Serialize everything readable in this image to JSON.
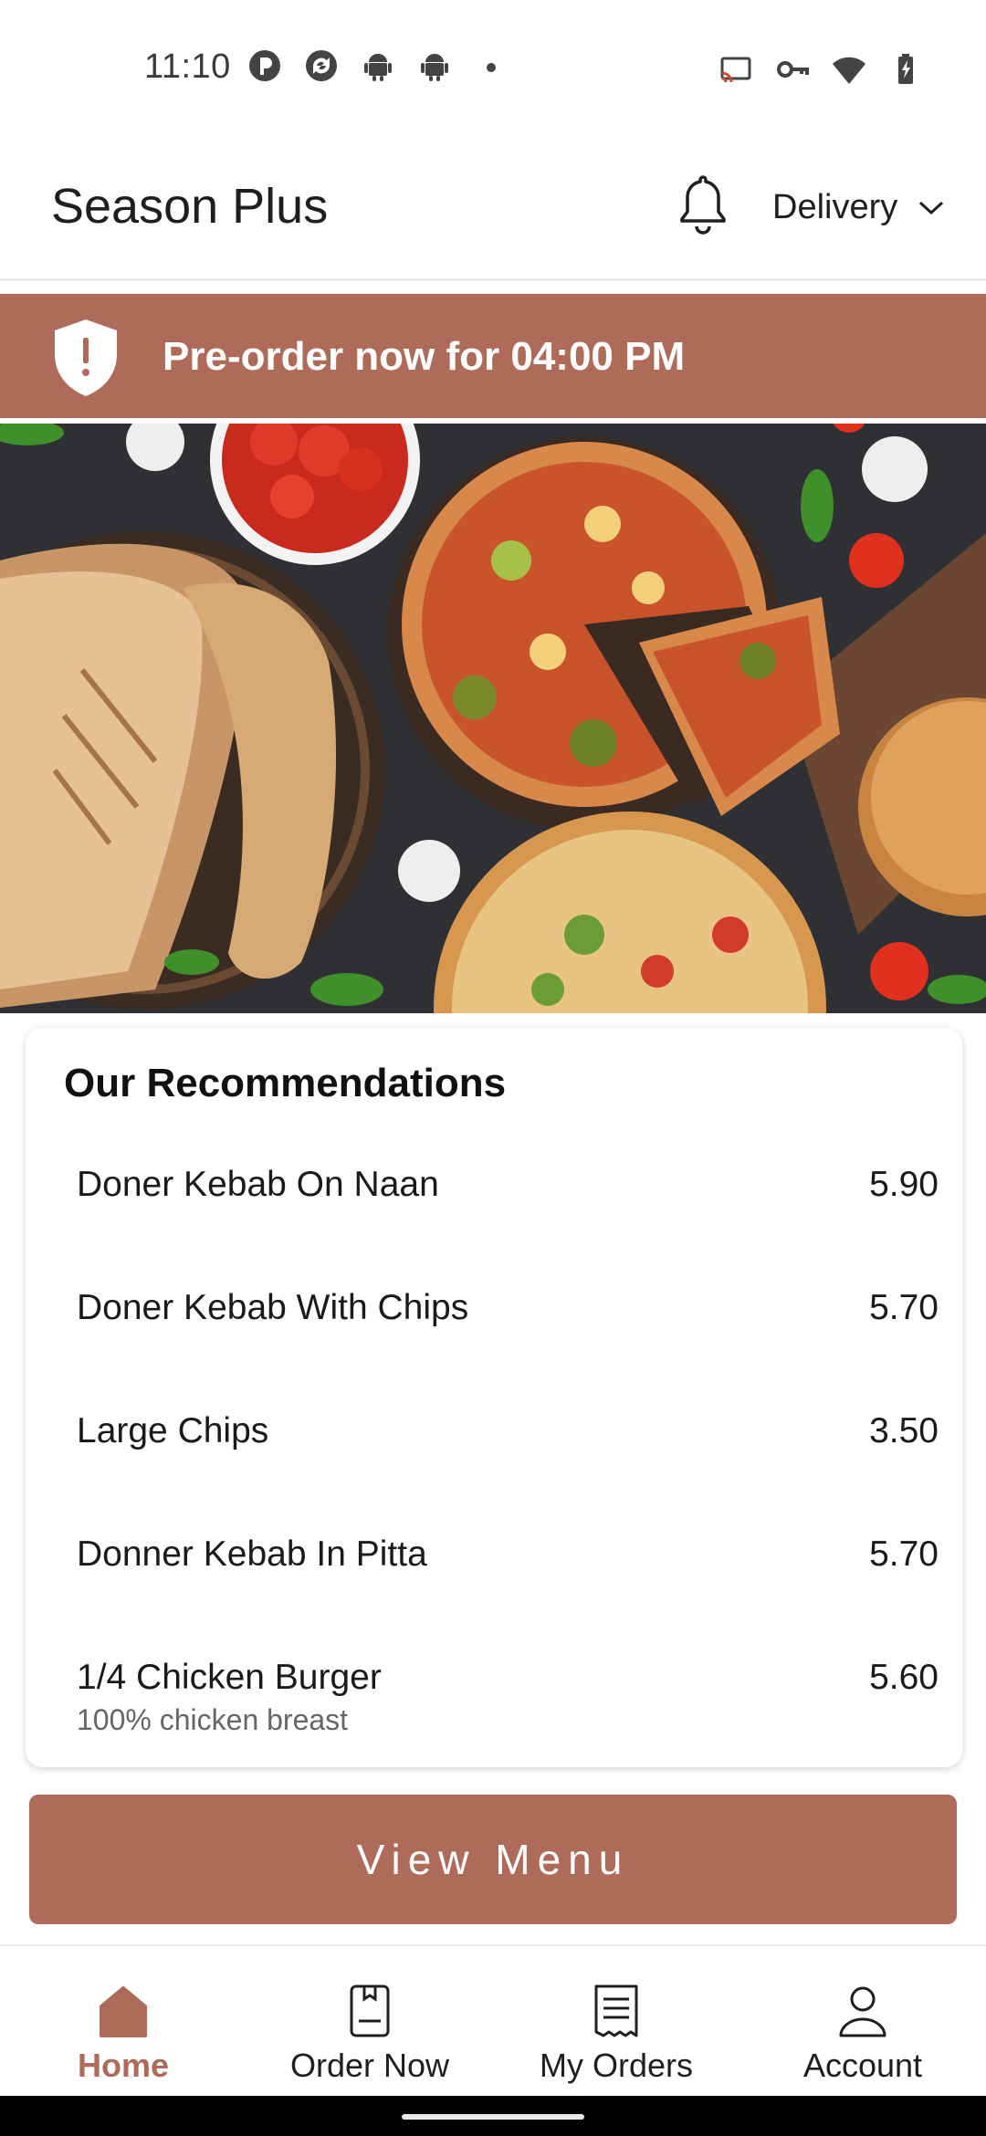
{
  "status_bar": {
    "time": "11:10",
    "left_icons": [
      "p-app-icon",
      "sync-icon",
      "android-icon",
      "android-icon",
      "dot-icon"
    ],
    "right_icons": [
      "cast-icon",
      "vpn-key-icon",
      "wifi-icon",
      "battery-charging-icon"
    ]
  },
  "header": {
    "title": "Season Plus",
    "notification_icon": "bell-icon",
    "mode_label": "Delivery",
    "mode_icon": "chevron-down-icon"
  },
  "banner": {
    "icon": "shield-alert-icon",
    "text": "Pre-order now for 04:00 PM"
  },
  "hero": {
    "icon": "hero-food-image"
  },
  "recommendations": {
    "title": "Our Recommendations",
    "items": [
      {
        "name": "Doner Kebab On Naan",
        "price": "5.90",
        "description": ""
      },
      {
        "name": "Doner Kebab With Chips",
        "price": "5.70",
        "description": ""
      },
      {
        "name": "Large Chips",
        "price": "3.50",
        "description": ""
      },
      {
        "name": "Donner Kebab In Pitta",
        "price": "5.70",
        "description": ""
      },
      {
        "name": "1/4 Chicken Burger",
        "price": "5.60",
        "description": "100% chicken breast"
      }
    ]
  },
  "view_menu_label": "View Menu",
  "bottom_nav": [
    {
      "label": "Home",
      "icon": "home-icon",
      "active": true
    },
    {
      "label": "Order Now",
      "icon": "order-icon",
      "active": false
    },
    {
      "label": "My Orders",
      "icon": "receipt-icon",
      "active": false
    },
    {
      "label": "Account",
      "icon": "user-icon",
      "active": false
    }
  ],
  "colors": {
    "accent": "#ae6b59",
    "background": "#ffffff",
    "text": "#1a1a1a"
  }
}
